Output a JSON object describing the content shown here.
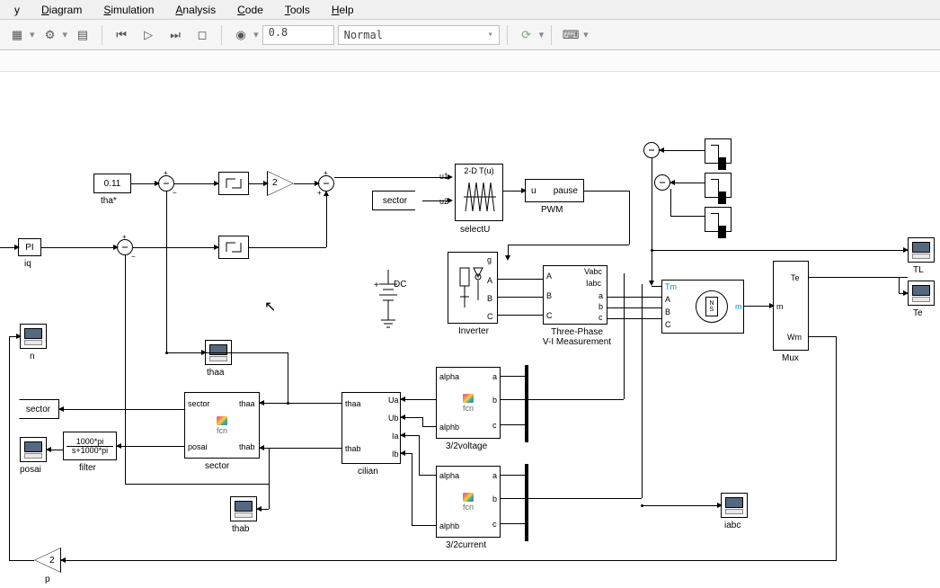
{
  "menu": {
    "items": [
      "y",
      "Diagram",
      "Simulation",
      "Analysis",
      "Code",
      "Tools",
      "Help"
    ]
  },
  "toolbar": {
    "sim_time": "0.8",
    "mode": "Normal"
  },
  "blocks": {
    "const_tha": "0.11",
    "const_tha_label": "tha*",
    "pi_label": "PI",
    "iq_label": "iq",
    "gain1": "2",
    "sector_tag": "sector",
    "selectU_label": "selectU",
    "selectU_title": "2-D T(u)",
    "selectU_u1": "u1",
    "selectU_u2": "u2",
    "pwm_label": "PWM",
    "pwm_u": "u",
    "pwm_pause": "pause",
    "dc_label": "DC",
    "inverter_label": "Inverter",
    "inverter_g": "g",
    "inverter_A": "A",
    "inverter_B": "B",
    "inverter_C": "C",
    "vi_label": "Three-Phase\nV-I Measurement",
    "vi_A": "A",
    "vi_B": "B",
    "vi_C": "C",
    "vi_Vabc": "Vabc",
    "vi_Iabc": "Iabc",
    "vi_a": "a",
    "vi_b": "b",
    "vi_c": "c",
    "motor_Tm": "Tm",
    "motor_A": "A",
    "motor_B": "B",
    "motor_C": "C",
    "motor_m": "m",
    "mux_label": "Mux",
    "mux_Te": "Te",
    "mux_m": "m",
    "mux_Wm": "Wm",
    "scope_TL": "TL",
    "scope_Te": "Te",
    "scope_n": "n",
    "scope_iabc": "iabc",
    "scope_thaa": "thaa",
    "scope_thab": "thab",
    "scope_posai": "posai",
    "thab_port": "thab",
    "thaa_port": "thaa",
    "sector_port": "sector",
    "posai_port": "posai",
    "tf_num": "1000*pi",
    "tf_den": "s+1000*pi",
    "tf_label": "filter",
    "sector_blk_label": "sector",
    "sector_blk_sector": "sector",
    "sector_blk_posai": "posai",
    "sector_blk_thaa": "thaa",
    "sector_blk_thab": "thab",
    "fcn": "fcn",
    "cilian_label": "cilian",
    "cilian_thaa": "thaa",
    "cilian_thab": "thab",
    "cilian_Ua": "Ua",
    "cilian_Ub": "Ub",
    "cilian_Ia": "Ia",
    "cilian_Ib": "Ib",
    "v32_label": "3/2voltage",
    "i32_label": "3/2current",
    "v32_alpha": "alpha",
    "v32_alphb": "alphb",
    "v32_a": "a",
    "v32_b": "b",
    "v32_c": "c",
    "i32_alpha": "alpha",
    "i32_alphb": "alphb",
    "i32_a": "a",
    "i32_b": "b",
    "i32_c": "c",
    "gain_p": "2",
    "p_label": "p"
  }
}
